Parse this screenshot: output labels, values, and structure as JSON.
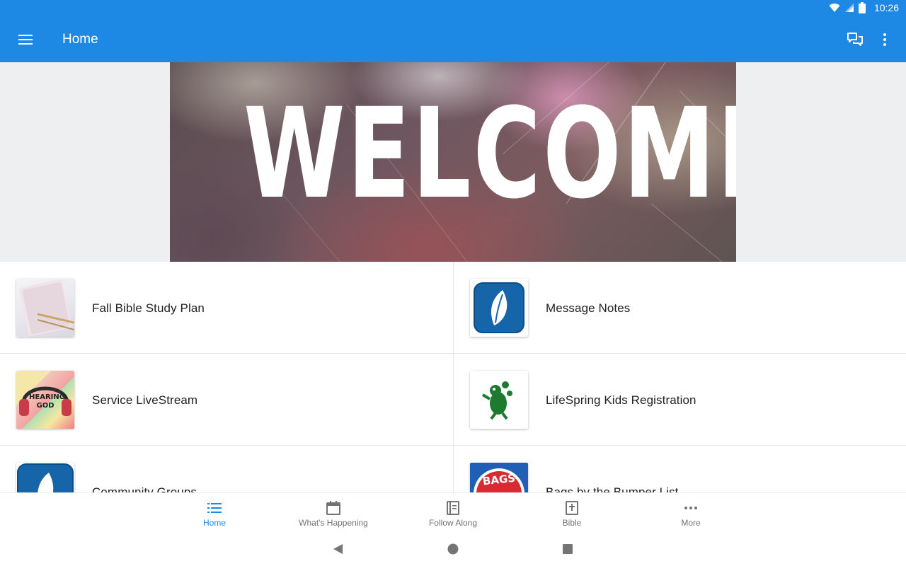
{
  "status_bar": {
    "time": "10:26"
  },
  "app_bar": {
    "title": "Home"
  },
  "banner": {
    "text": "WELCOME"
  },
  "tiles": [
    {
      "label": "Fall Bible Study Plan",
      "thumb": "notebook-thumb"
    },
    {
      "label": "Message Notes",
      "thumb": "leaf-logo-thumb"
    },
    {
      "label": "Service LiveStream",
      "thumb": "hearing-god-thumb",
      "thumb_text": "HEARING GOD"
    },
    {
      "label": "LifeSpring Kids Registration",
      "thumb": "kids-frog-thumb"
    },
    {
      "label": "Community Groups",
      "thumb": "leaf-logo-thumb"
    },
    {
      "label": "Bags by the Bumper List",
      "thumb": "bags-thumb",
      "thumb_text": "BAGS"
    }
  ],
  "bottom_nav": [
    {
      "label": "Home",
      "icon": "list-icon",
      "active": true
    },
    {
      "label": "What's Happening",
      "icon": "calendar-icon",
      "active": false
    },
    {
      "label": "Follow Along",
      "icon": "notes-icon",
      "active": false
    },
    {
      "label": "Bible",
      "icon": "bible-icon",
      "active": false
    },
    {
      "label": "More",
      "icon": "more-dots-icon",
      "active": false
    }
  ],
  "colors": {
    "primary": "#1e88e5",
    "banner_bg": "#eeeff0",
    "text": "#212121",
    "nav_inactive": "#737373"
  }
}
